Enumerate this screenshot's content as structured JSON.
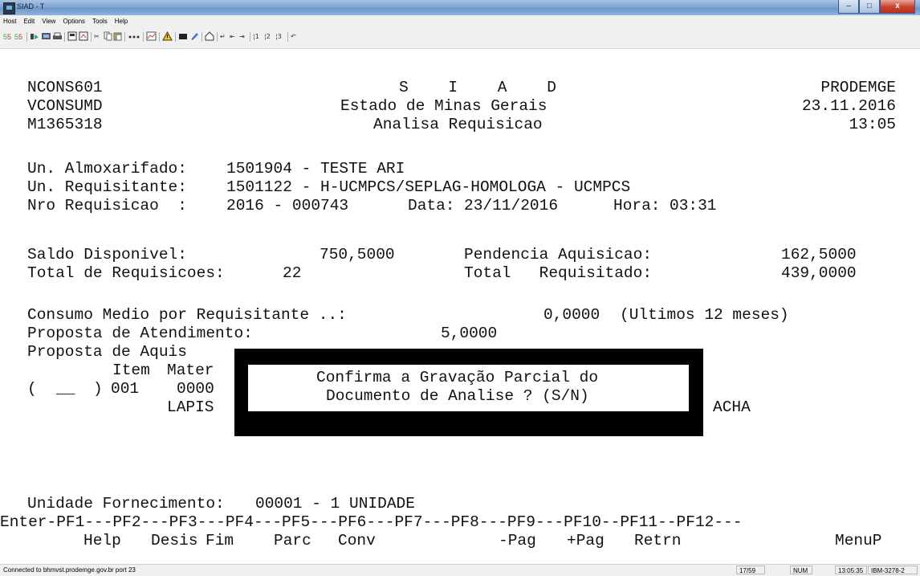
{
  "window": {
    "title": "SIAD - T"
  },
  "window_controls": {
    "minimize": "–",
    "maximize": "□",
    "close": "x"
  },
  "menu": [
    "Host",
    "Edit",
    "View",
    "Options",
    "Tools",
    "Help"
  ],
  "toolbar_icons": [
    "send-icon",
    "receive-icon",
    "macro-icon",
    "connect-icon",
    "print-icon",
    "save-icon",
    "open-icon",
    "cut-icon",
    "copy-icon",
    "paste-icon",
    "record-icon",
    "chart-icon",
    "warning-icon",
    "screen-icon",
    "brush-icon",
    "home-icon",
    "enter-icon",
    "field-left-icon",
    "field-right-icon",
    "pf1-icon",
    "pf2-icon",
    "pf3-icon",
    "undo-icon"
  ],
  "screen": {
    "program": "NCONS601",
    "system": "S I A D",
    "org": "PRODEMGE",
    "view": "VCONSUMD",
    "state": "Estado de Minas Gerais",
    "date": "23.11.2016",
    "user": "M1365318",
    "function": "Analisa Requisicao",
    "time": "13:05",
    "almox_label": "Un. Almoxarifado:",
    "almox_value": "1501904 - TESTE ARI",
    "requisitante_label": "Un. Requisitante:",
    "requisitante_value": "1501122 - H-UCMPCS/SEPLAG-HOMOLOGA - UCMPCS",
    "nro_label": "Nro Requisicao  :",
    "nro_value": "2016 - 000743",
    "data_label": "Data:",
    "data_value": "23/11/2016",
    "hora_label": "Hora:",
    "hora_value": "03:31",
    "saldo_label": "Saldo Disponivel:",
    "saldo_value": "750,5000",
    "pendencia_label": "Pendencia Aquisicao:",
    "pendencia_value": "162,5000",
    "total_req_label": "Total de Requisicoes:",
    "total_req_value": "22",
    "total_requisitado_label": "Total   Requisitado:",
    "total_requisitado_value": "439,0000",
    "consumo_label": "Consumo Medio por Requisitante ..:",
    "consumo_value": "0,0000",
    "consumo_note": "(Ultimos 12 meses)",
    "proposta_atend_label": "Proposta de Atendimento:",
    "proposta_atend_value": "5,0000",
    "proposta_aquis_label": "Proposta de Aquis",
    "item_header": "Item",
    "mater_header": "Mater",
    "row_select_open": "(",
    "row_select_field": "__",
    "row_select_close": ")",
    "row_item": "001",
    "row_mater": "0000",
    "row_desc": "LAPIS",
    "row_acha": "ACHA",
    "unidade_label": "Unidade Fornecimento:",
    "unidade_value": "00001 - 1 UNIDADE",
    "pf_keys_line": "Enter-PF1---PF2---PF3---PF4---PF5---PF6---PF7---PF8---PF9---PF10--PF11--PF12---",
    "pf_labels": {
      "pf1": "Help",
      "pf2": "Desis",
      "pf3": "Fim",
      "pf4": "Parc",
      "pf5": "Conv",
      "pf7": "-Pag",
      "pf8": "+Pag",
      "pf9": "Retrn",
      "pf12": "MenuP"
    }
  },
  "dialog": {
    "line1": "Confirma a Gravação Parcial do",
    "line2": "Documento de Analise ? (S/N)",
    "input_value": "_"
  },
  "status": {
    "connection": "Connected to bhmvst.prodemge.gov.br port 23",
    "cursor": "17/59",
    "numlock": "NUM",
    "time": "13:05:35",
    "terminal_type": "IBM-3278-2"
  },
  "colors": {
    "screen_bg": "#ffffff",
    "screen_text": "#111111",
    "dialog_border": "#000000"
  }
}
